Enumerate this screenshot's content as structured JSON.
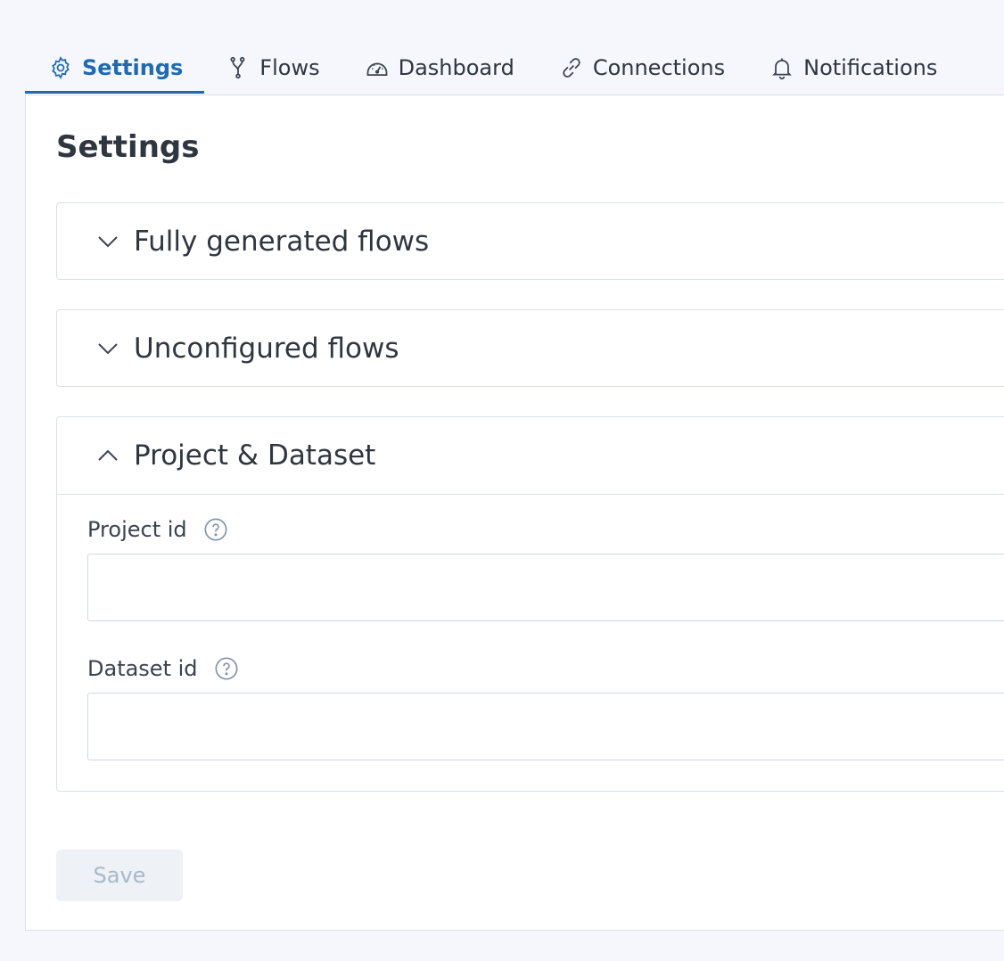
{
  "tabs": [
    {
      "label": "Settings",
      "icon": "gear-icon",
      "active": true
    },
    {
      "label": "Flows",
      "icon": "flow-branch-icon",
      "active": false
    },
    {
      "label": "Dashboard",
      "icon": "speedometer-icon",
      "active": false
    },
    {
      "label": "Connections",
      "icon": "link-icon",
      "active": false
    },
    {
      "label": "Notifications",
      "icon": "bell-icon",
      "active": false
    }
  ],
  "page": {
    "title": "Settings"
  },
  "sections": [
    {
      "title": "Fully generated flows",
      "expanded": false
    },
    {
      "title": "Unconfigured flows",
      "expanded": false
    },
    {
      "title": "Project & Dataset",
      "expanded": true
    }
  ],
  "fields": {
    "project_id": {
      "label": "Project id",
      "value": "",
      "placeholder": ""
    },
    "dataset_id": {
      "label": "Dataset id",
      "value": "",
      "placeholder": ""
    }
  },
  "actions": {
    "save_label": "Save",
    "save_disabled": true
  },
  "colors": {
    "accent": "#1f6ab3",
    "background": "#f5f7fc",
    "border": "#d7e0ec",
    "disabled_button_bg": "#eef1f5",
    "disabled_button_text": "#a9b8c9"
  }
}
